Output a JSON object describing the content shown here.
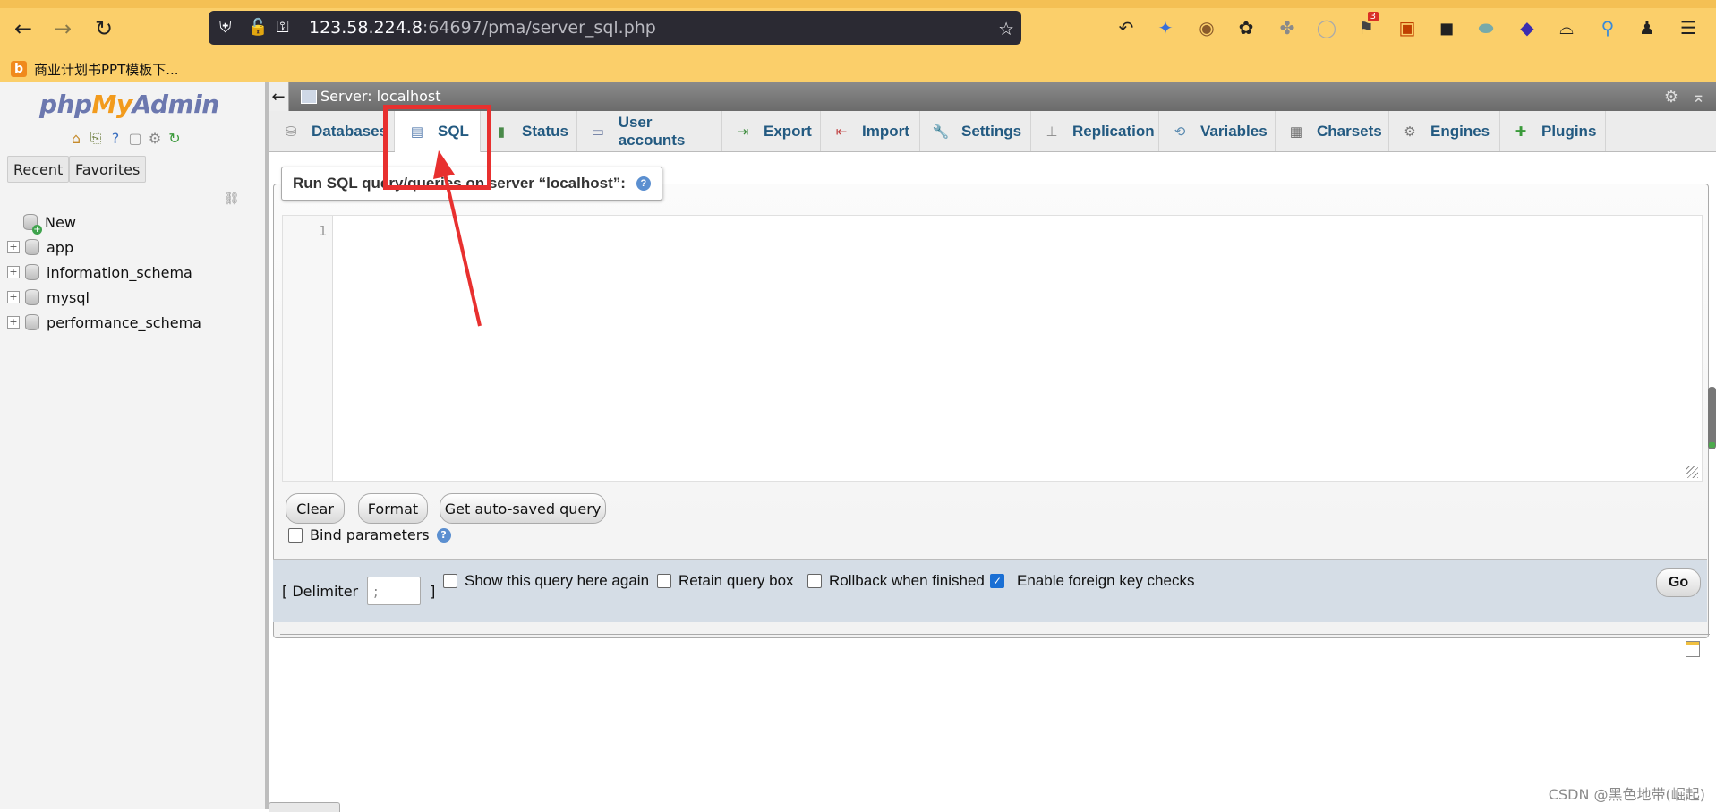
{
  "browser": {
    "url_host": "123.58.224.8",
    "url_port": ":64697",
    "url_path": "/pma/server_sql.php",
    "bookmark": "商业计划书PPT模板下...",
    "ext_badge": "3"
  },
  "sidebar": {
    "logo_php": "php",
    "logo_my": "My",
    "logo_admin": "Admin",
    "recent_label": "Recent",
    "favorites_label": "Favorites",
    "tree": {
      "new": "New",
      "databases": [
        "app",
        "information_schema",
        "mysql",
        "performance_schema"
      ]
    }
  },
  "breadcrumb": {
    "server": "Server: localhost"
  },
  "tabs": [
    "Databases",
    "SQL",
    "Status",
    "User accounts",
    "Export",
    "Import",
    "Settings",
    "Replication",
    "Variables",
    "Charsets",
    "Engines",
    "Plugins"
  ],
  "active_tab": "SQL",
  "query_panel": {
    "legend": "Run SQL query/queries on server “localhost”:",
    "line_number": "1",
    "clear_label": "Clear",
    "format_label": "Format",
    "autosave_label": "Get auto-saved query",
    "bind_params_label": "Bind parameters"
  },
  "options": {
    "delimiter_label": "[ Delimiter",
    "delimiter_value": ";",
    "delimiter_close": "]",
    "show_query_label": "Show this query here again",
    "retain_box_label": "Retain query box",
    "rollback_label": "Rollback when finished",
    "foreign_key_label": "Enable foreign key checks",
    "foreign_key_checked": true,
    "go_label": "Go"
  },
  "watermark": "CSDN @黑色地带(崛起)",
  "colors": {
    "annotation": "#e8302f",
    "tab_text": "#235a81",
    "browser_bar": "#fbcf6a"
  }
}
